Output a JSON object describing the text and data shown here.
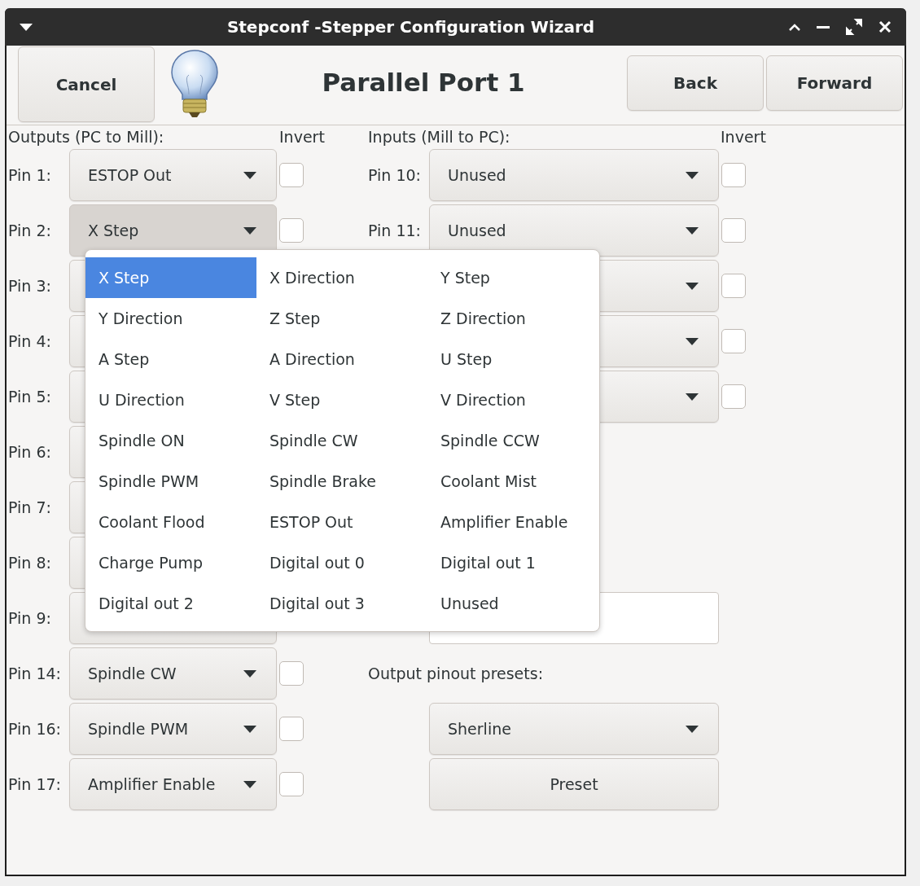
{
  "window": {
    "title": "Stepconf -Stepper Configuration Wizard"
  },
  "header": {
    "cancel": "Cancel",
    "title": "Parallel Port 1",
    "back": "Back",
    "forward": "Forward"
  },
  "outputs": {
    "heading": "Outputs (PC to Mill):",
    "invert_heading": "Invert",
    "pins": [
      {
        "label": "Pin 1:",
        "value": "ESTOP Out",
        "open": false,
        "checked": false
      },
      {
        "label": "Pin 2:",
        "value": "X Step",
        "open": true,
        "checked": false
      },
      {
        "label": "Pin 3:",
        "open": false
      },
      {
        "label": "Pin 4:",
        "open": false
      },
      {
        "label": "Pin 5:",
        "open": false
      },
      {
        "label": "Pin 6:",
        "open": false
      },
      {
        "label": "Pin 7:",
        "open": false
      },
      {
        "label": "Pin 8:",
        "open": false
      },
      {
        "label": "Pin 9:",
        "open": false
      },
      {
        "label": "Pin 14:",
        "value": "Spindle CW",
        "open": false,
        "checked": false
      },
      {
        "label": "Pin 16:",
        "value": "Spindle PWM",
        "open": false,
        "checked": false
      },
      {
        "label": "Pin 17:",
        "value": "Amplifier Enable",
        "open": false,
        "checked": false
      }
    ]
  },
  "inputs": {
    "heading": "Inputs (Mill to PC):",
    "invert_heading": "Invert",
    "pins": [
      {
        "label": "Pin 10:",
        "value": "Unused",
        "checked": false
      },
      {
        "label": "Pin 11:",
        "value": "Unused",
        "checked": false
      },
      {
        "checked": false
      },
      {
        "checked": false
      },
      {
        "checked": false
      }
    ]
  },
  "presets": {
    "label": "Output pinout presets:",
    "value": "Sherline",
    "button": "Preset"
  },
  "dropdown_menu": {
    "items": [
      {
        "label": "X Step",
        "selected": true
      },
      {
        "label": "X Direction",
        "selected": false
      },
      {
        "label": "Y Step",
        "selected": false
      },
      {
        "label": "Y Direction",
        "selected": false
      },
      {
        "label": "Z Step",
        "selected": false
      },
      {
        "label": "Z Direction",
        "selected": false
      },
      {
        "label": "A Step",
        "selected": false
      },
      {
        "label": "A Direction",
        "selected": false
      },
      {
        "label": "U Step",
        "selected": false
      },
      {
        "label": "U Direction",
        "selected": false
      },
      {
        "label": "V Step",
        "selected": false
      },
      {
        "label": "V Direction",
        "selected": false
      },
      {
        "label": "Spindle ON",
        "selected": false
      },
      {
        "label": "Spindle CW",
        "selected": false
      },
      {
        "label": "Spindle CCW",
        "selected": false
      },
      {
        "label": "Spindle PWM",
        "selected": false
      },
      {
        "label": "Spindle Brake",
        "selected": false
      },
      {
        "label": "Coolant Mist",
        "selected": false
      },
      {
        "label": "Coolant Flood",
        "selected": false
      },
      {
        "label": "ESTOP Out",
        "selected": false
      },
      {
        "label": "Amplifier Enable",
        "selected": false
      },
      {
        "label": "Charge Pump",
        "selected": false
      },
      {
        "label": "Digital out 0",
        "selected": false
      },
      {
        "label": "Digital out 1",
        "selected": false
      },
      {
        "label": "Digital out 2",
        "selected": false
      },
      {
        "label": "Digital out 3",
        "selected": false
      },
      {
        "label": "Unused",
        "selected": false
      }
    ]
  }
}
